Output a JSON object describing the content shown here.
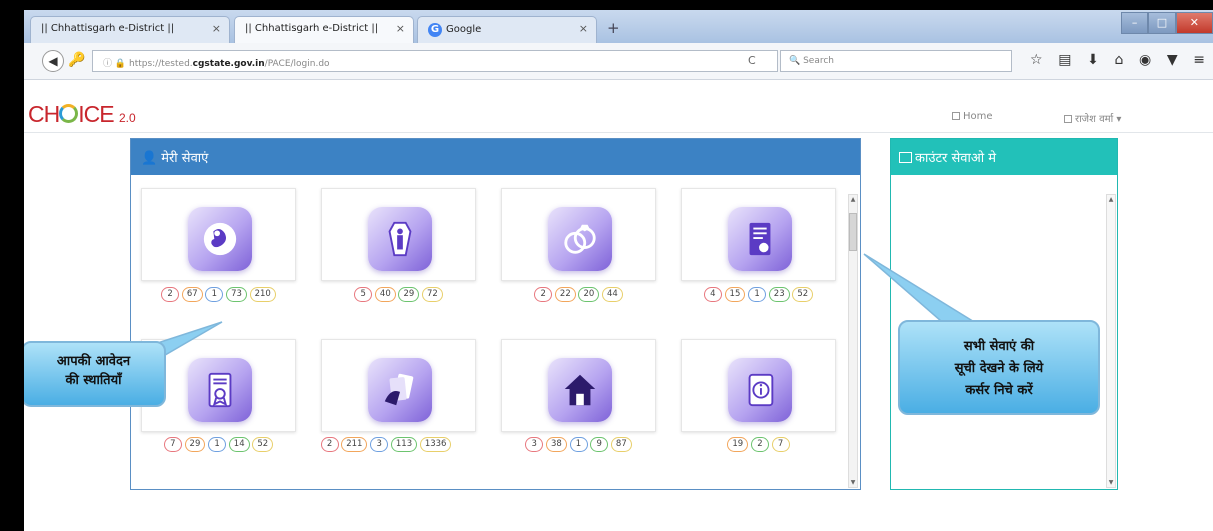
{
  "browser": {
    "tabs": [
      {
        "title": "|| Chhattisgarh e-District ||"
      },
      {
        "title": "|| Chhattisgarh e-District ||"
      },
      {
        "title": "Google"
      }
    ],
    "url_prefix": "https://tested.",
    "url_domain": "cgstate.gov.in",
    "url_path": "/PACE/login.do",
    "search_placeholder": "Search"
  },
  "app": {
    "logo_text_1": "CH",
    "logo_text_2": "ICE",
    "logo_version": "2.0",
    "home_label": "Home",
    "user_label": "राजेश वर्मा"
  },
  "services_panel": {
    "title": "मेरी सेवाएं",
    "tiles": [
      {
        "icon": "baby-icon",
        "counts": [
          "2",
          "67",
          "1",
          "73",
          "210"
        ]
      },
      {
        "icon": "coffin-icon",
        "counts": [
          "5",
          "40",
          "29",
          "72"
        ]
      },
      {
        "icon": "rings-icon",
        "counts": [
          "2",
          "22",
          "20",
          "44"
        ]
      },
      {
        "icon": "certificate-icon",
        "counts": [
          "4",
          "15",
          "1",
          "23",
          "52"
        ]
      },
      {
        "icon": "document-icon",
        "counts": [
          "7",
          "29",
          "1",
          "14",
          "52"
        ]
      },
      {
        "icon": "cards-icon",
        "counts": [
          "2",
          "211",
          "3",
          "113",
          "1336"
        ]
      },
      {
        "icon": "house-icon",
        "counts": [
          "3",
          "38",
          "1",
          "9",
          "87"
        ]
      },
      {
        "icon": "info-book-icon",
        "counts": [
          "19",
          "2",
          "7"
        ]
      }
    ]
  },
  "counter_panel": {
    "title": "काउंटर सेवाओ मे"
  },
  "callouts": {
    "status_line1": "आपकी आवेदन",
    "status_line2": "की स्थातियाँ",
    "list_line1": "सभी सेवाएं की",
    "list_line2": "सूची देखने के लिये",
    "list_line3": "कर्सर निचे करें"
  },
  "colors": {
    "services_header": "#3c82c4",
    "counter_header": "#22c1b9",
    "logo_red": "#c8262d"
  }
}
